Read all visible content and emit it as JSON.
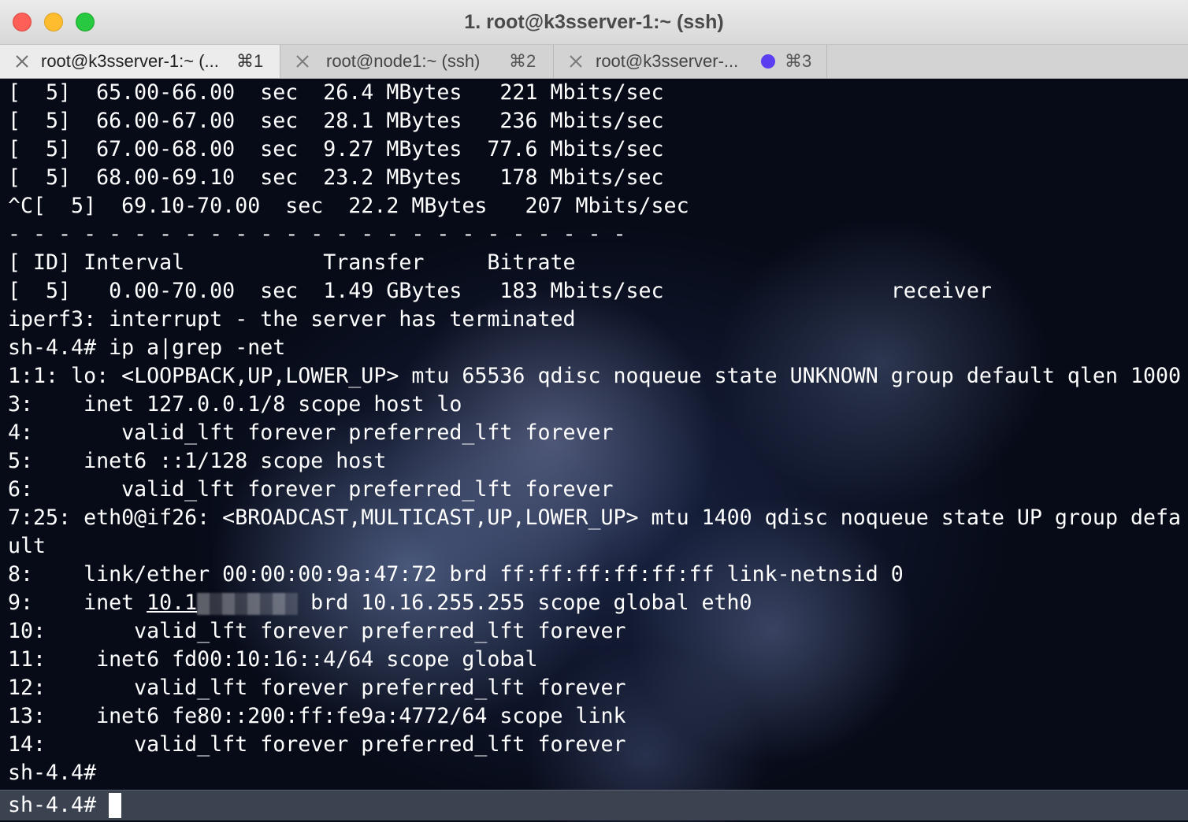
{
  "window": {
    "title": "1. root@k3sserver-1:~ (ssh)"
  },
  "tabs": [
    {
      "label": "root@k3sserver-1:~ (...",
      "shortcut": "⌘1",
      "active": true
    },
    {
      "label": "root@node1:~ (ssh)",
      "shortcut": "⌘2",
      "active": false
    },
    {
      "label": "root@k3sserver-...",
      "shortcut": "⌘3",
      "active": false,
      "activity": true
    }
  ],
  "colors": {
    "activity_dot": "#5b3df2",
    "close_red": "#fe5f57",
    "minimize_yellow": "#febc2e",
    "zoom_green": "#28c840"
  },
  "terminal": {
    "lines": [
      "[  5]  65.00-66.00  sec  26.4 MBytes   221 Mbits/sec",
      "[  5]  66.00-67.00  sec  28.1 MBytes   236 Mbits/sec",
      "[  5]  67.00-68.00  sec  9.27 MBytes  77.6 Mbits/sec",
      "[  5]  68.00-69.10  sec  23.2 MBytes   178 Mbits/sec",
      "^C[  5]  69.10-70.00  sec  22.2 MBytes   207 Mbits/sec",
      "- - - - - - - - - - - - - - - - - - - - - - - - -",
      "[ ID] Interval           Transfer     Bitrate",
      "[  5]   0.00-70.00  sec  1.49 GBytes   183 Mbits/sec                  receiver",
      "iperf3: interrupt - the server has terminated",
      "sh-4.4# ip a|grep -net",
      "1:1: lo: <LOOPBACK,UP,LOWER_UP> mtu 65536 qdisc noqueue state UNKNOWN group default qlen 1000",
      "3:    inet 127.0.0.1/8 scope host lo",
      "4:       valid_lft forever preferred_lft forever",
      "5:    inet6 ::1/128 scope host",
      "6:       valid_lft forever preferred_lft forever",
      "7:25: eth0@if26: <BROADCAST,MULTICAST,UP,LOWER_UP> mtu 1400 qdisc noqueue state UP group defa",
      "ult",
      "8:    link/ether 00:00:00:9a:47:72 brd ff:ff:ff:ff:ff:ff link-netnsid 0"
    ],
    "line9": {
      "prefix": "9:    inet ",
      "ip_visible": "10.1",
      "suffix": " brd 10.16.255.255 scope global eth0"
    },
    "lines_after": [
      "10:       valid_lft forever preferred_lft forever",
      "11:    inet6 fd00:10:16::4/64 scope global",
      "12:       valid_lft forever preferred_lft forever",
      "13:    inet6 fe80::200:ff:fe9a:4772/64 scope link",
      "14:       valid_lft forever preferred_lft forever",
      "sh-4.4#"
    ],
    "prompt": "sh-4.4#"
  }
}
